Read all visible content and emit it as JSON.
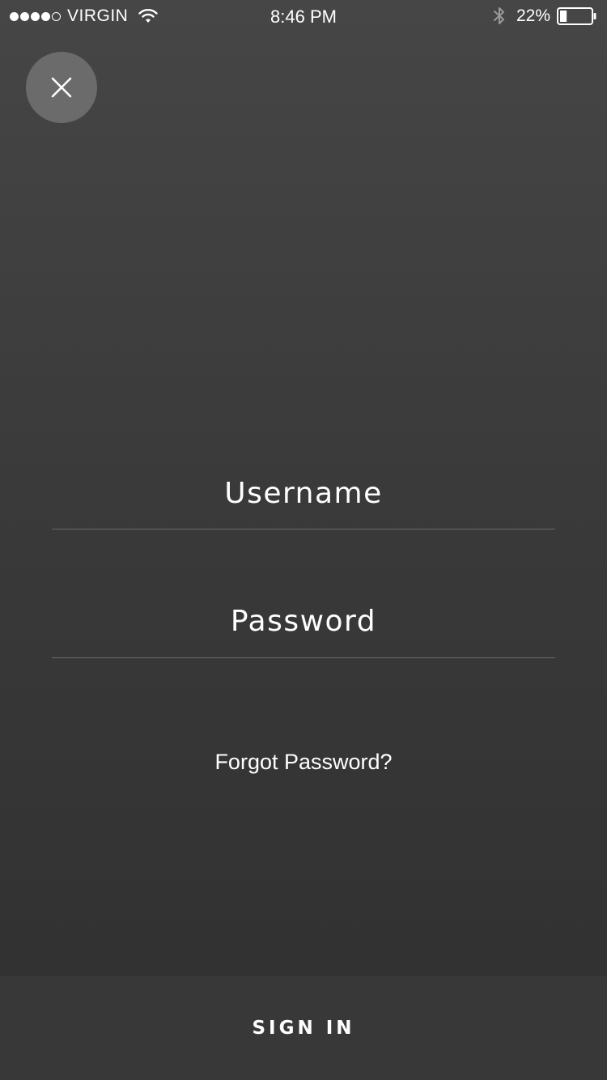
{
  "status_bar": {
    "carrier": "VIRGIN",
    "signal_strength": 4,
    "signal_max": 5,
    "time": "8:46 PM",
    "battery_percent": "22%",
    "battery_level": 0.22
  },
  "login": {
    "username_placeholder": "Username",
    "password_placeholder": "Password",
    "forgot_password_label": "Forgot Password?",
    "sign_in_label": "SIGN IN"
  },
  "icons": {
    "close": "close-icon",
    "wifi": "wifi-icon",
    "bluetooth": "bluetooth-icon",
    "battery": "battery-icon"
  },
  "colors": {
    "background_top": "#464646",
    "background_bottom": "#303030",
    "close_button_bg": "#6b6b6b",
    "sign_in_bar_bg": "#383838",
    "divider": "#6a6a6a",
    "text": "#ffffff"
  }
}
